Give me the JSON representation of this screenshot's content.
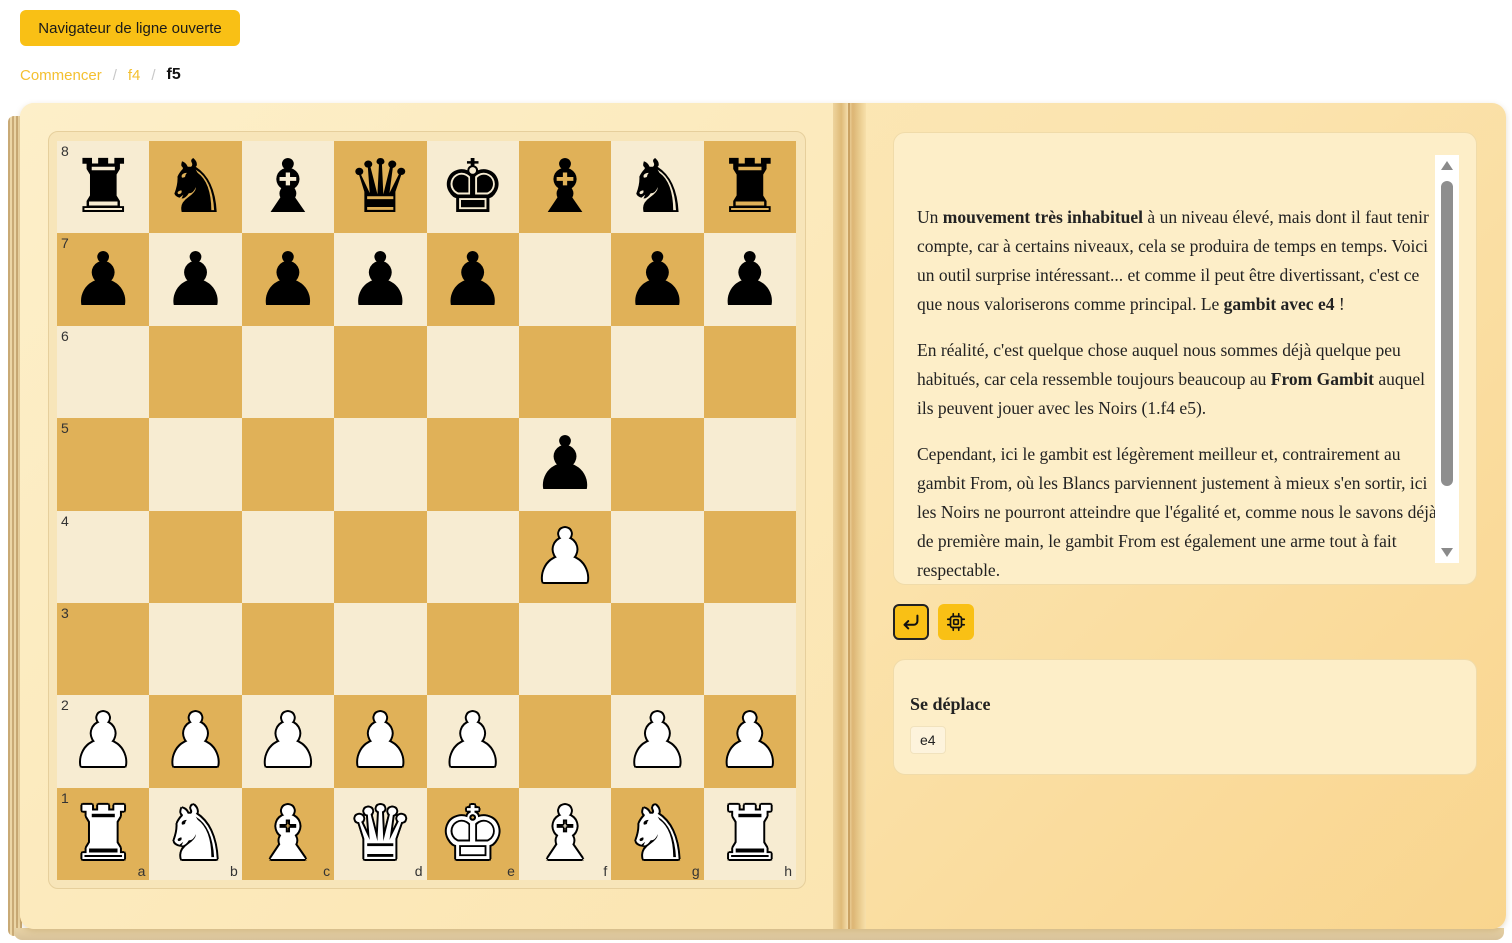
{
  "header": {
    "open_line_button": "Navigateur de ligne ouverte"
  },
  "breadcrumb": {
    "items": [
      "Commencer",
      "f4",
      "f5"
    ],
    "separator": "/"
  },
  "board": {
    "ranks": [
      "8",
      "7",
      "6",
      "5",
      "4",
      "3",
      "2",
      "1"
    ],
    "files": [
      "a",
      "b",
      "c",
      "d",
      "e",
      "f",
      "g",
      "h"
    ],
    "light_color": "#f7ecd2",
    "dark_color": "#e0b158",
    "position": [
      [
        "bR",
        "bN",
        "bB",
        "bQ",
        "bK",
        "bB",
        "bN",
        "bR"
      ],
      [
        "bP",
        "bP",
        "bP",
        "bP",
        "bP",
        "",
        "bP",
        "bP"
      ],
      [
        "",
        "",
        "",
        "",
        "",
        "",
        "",
        ""
      ],
      [
        "",
        "",
        "",
        "",
        "",
        "bP",
        "",
        ""
      ],
      [
        "",
        "",
        "",
        "",
        "",
        "wP",
        "",
        ""
      ],
      [
        "",
        "",
        "",
        "",
        "",
        "",
        "",
        ""
      ],
      [
        "wP",
        "wP",
        "wP",
        "wP",
        "wP",
        "",
        "wP",
        "wP"
      ],
      [
        "wR",
        "wN",
        "wB",
        "wQ",
        "wK",
        "wB",
        "wN",
        "wR"
      ]
    ]
  },
  "text": {
    "p1_a": "Un ",
    "p1_b": "mouvement très inhabituel",
    "p1_c": " à un niveau élevé, mais dont il faut tenir compte, car à certains niveaux, cela se produira de temps en temps. Voici un outil surprise intéressant... et comme il peut être divertissant, c'est ce que nous valoriserons comme principal. Le ",
    "p1_d": "gambit avec e4",
    "p1_e": " !",
    "p2_a": "En réalité, c'est quelque chose auquel nous sommes déjà quelque peu habitués, car cela ressemble toujours beaucoup au ",
    "p2_b": "From Gambit",
    "p2_c": " auquel ils peuvent jouer avec les Noirs (1.f4 e5).",
    "p3": "Cependant, ici le gambit est légèrement meilleur et, contrairement au gambit From, où les Blancs parviennent justement à mieux s'en sortir, ici les Noirs ne pourront atteindre que l'égalité et, comme nous le savons déjà de première main, le gambit From est également une arme tout à fait respectable."
  },
  "toolbar": {
    "back_icon": "return-arrow-icon",
    "engine_icon": "cpu-chip-icon"
  },
  "moves": {
    "title": "Se déplace",
    "items": [
      "e4"
    ]
  },
  "colors": {
    "accent": "#f9c015",
    "breadcrumb_link": "#f4c030"
  }
}
